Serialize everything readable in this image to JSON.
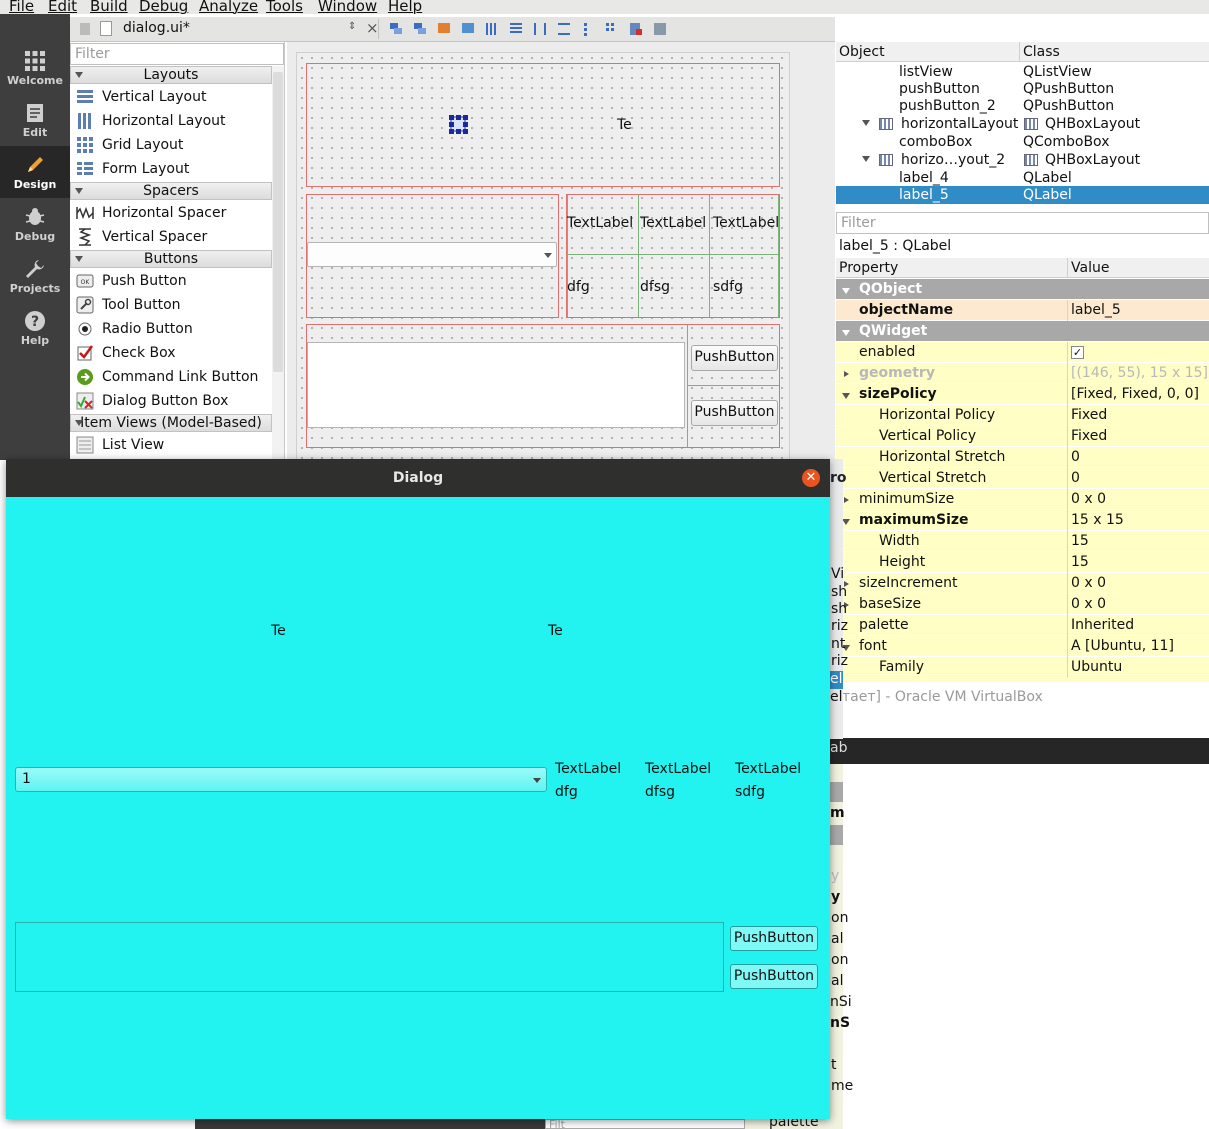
{
  "menu": [
    "File",
    "Edit",
    "Build",
    "Debug",
    "Analyze",
    "Tools",
    "Window",
    "Help"
  ],
  "modes": [
    {
      "label": "Welcome",
      "icon": "grid-icon"
    },
    {
      "label": "Edit",
      "icon": "document-icon"
    },
    {
      "label": "Design",
      "icon": "pencil-icon"
    },
    {
      "label": "Debug",
      "icon": "bug-icon"
    },
    {
      "label": "Projects",
      "icon": "wrench-icon"
    },
    {
      "label": "Help",
      "icon": "question-icon"
    }
  ],
  "editor": {
    "file_tab": "dialog.ui*"
  },
  "widgetbox": {
    "filter_placeholder": "Filter",
    "categories": {
      "layouts": "Layouts",
      "spacers": "Spacers",
      "buttons": "Buttons",
      "itemviews": "Item Views (Model-Based)"
    },
    "items": {
      "vertical_layout": "Vertical Layout",
      "horizontal_layout": "Horizontal Layout",
      "grid_layout": "Grid Layout",
      "form_layout": "Form Layout",
      "horizontal_spacer": "Horizontal Spacer",
      "vertical_spacer": "Vertical Spacer",
      "push_button": "Push Button",
      "tool_button": "Tool Button",
      "radio_button": "Radio Button",
      "check_box": "Check Box",
      "command_link": "Command Link Button",
      "dialog_button_box": "Dialog Button Box",
      "list_view": "List View"
    }
  },
  "form": {
    "top_label": "Te",
    "grid_headers": [
      "TextLabel",
      "TextLabel",
      "TextLabel"
    ],
    "grid_values": [
      "dfg",
      "dfsg",
      "sdfg"
    ],
    "button1": "PushButton",
    "button2": "PushButton"
  },
  "object_inspector": {
    "headers": {
      "object": "Object",
      "class": "Class"
    },
    "rows": [
      {
        "object": "listView",
        "class": "QListView"
      },
      {
        "object": "pushButton",
        "class": "QPushButton"
      },
      {
        "object": "pushButton_2",
        "class": "QPushButton"
      },
      {
        "object": "horizontalLayout",
        "class": "QHBoxLayout"
      },
      {
        "object": "comboBox",
        "class": "QComboBox"
      },
      {
        "object": "horizo…yout_2",
        "class": "QHBoxLayout"
      },
      {
        "object": "label_4",
        "class": "QLabel"
      },
      {
        "object": "label_5",
        "class": "QLabel"
      }
    ]
  },
  "property_editor": {
    "filter_placeholder": "Filter",
    "class_line": "label_5 : QLabel",
    "headers": {
      "property": "Property",
      "value": "Value"
    },
    "rows": [
      {
        "name": "QObject",
        "value": ""
      },
      {
        "name": "objectName",
        "value": "label_5"
      },
      {
        "name": "QWidget",
        "value": ""
      },
      {
        "name": "enabled",
        "value": "✓"
      },
      {
        "name": "geometry",
        "value": "[(146, 55), 15 x 15]"
      },
      {
        "name": "sizePolicy",
        "value": "[Fixed, Fixed, 0, 0]"
      },
      {
        "name": "Horizontal Policy",
        "value": "Fixed"
      },
      {
        "name": "Vertical Policy",
        "value": "Fixed"
      },
      {
        "name": "Horizontal Stretch",
        "value": "0"
      },
      {
        "name": "Vertical Stretch",
        "value": "0"
      },
      {
        "name": "minimumSize",
        "value": "0 x 0"
      },
      {
        "name": "maximumSize",
        "value": "15 x 15"
      },
      {
        "name": "Width",
        "value": "15"
      },
      {
        "name": "Height",
        "value": "15"
      },
      {
        "name": "sizeIncrement",
        "value": "0 x 0"
      },
      {
        "name": "baseSize",
        "value": "0 x 0"
      },
      {
        "name": "palette",
        "value": "Inherited"
      },
      {
        "name": "font",
        "value": "A  [Ubuntu, 11]"
      },
      {
        "name": "Family",
        "value": "Ubuntu"
      }
    ]
  },
  "background_fragments": {
    "vbox_title": "тает] - Oracle VM VirtualBox",
    "right_edge_text": [
      "ro",
      "Vi",
      "sh",
      "sh",
      "riz",
      "nt",
      "riz",
      "el",
      "el",
      "ab",
      "m",
      "y",
      "y",
      "on",
      "al",
      "on",
      "al",
      "nSi",
      "nS",
      "t",
      "me"
    ],
    "bottom_text": "palette",
    "bottom_filter": "Filt"
  },
  "dialog": {
    "title": "Dialog",
    "labels": [
      "Te",
      "Te"
    ],
    "combo_value": "1",
    "grid_headers": [
      "TextLabel",
      "TextLabel",
      "TextLabel"
    ],
    "grid_values": [
      "dfg",
      "dfsg",
      "sdfg"
    ],
    "button1": "PushButton",
    "button2": "PushButton",
    "background_color": "#22f3f0"
  }
}
